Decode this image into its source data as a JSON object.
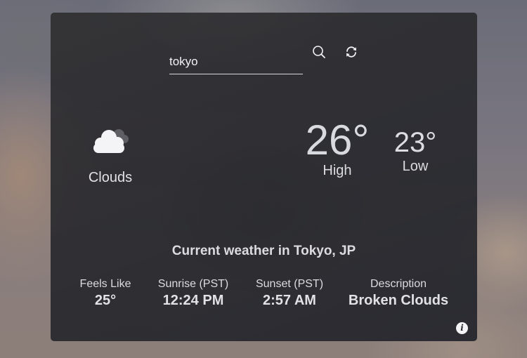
{
  "search": {
    "value": "tokyo",
    "placeholder": "",
    "search_icon": "search-icon",
    "refresh_icon": "refresh-icon"
  },
  "current": {
    "condition": "Clouds",
    "condition_icon": "cloud-icon",
    "high": "26°",
    "high_label": "High",
    "low": "23°",
    "low_label": "Low"
  },
  "location": {
    "title": "Current weather in Tokyo, JP"
  },
  "stats": [
    {
      "label": "Feels Like",
      "value": "25°"
    },
    {
      "label": "Sunrise (PST)",
      "value": "12:24 PM"
    },
    {
      "label": "Sunset (PST)",
      "value": "2:57 AM"
    },
    {
      "label": "Description",
      "value": "Broken Clouds"
    }
  ],
  "info": {
    "icon": "info-icon",
    "glyph": "i"
  }
}
